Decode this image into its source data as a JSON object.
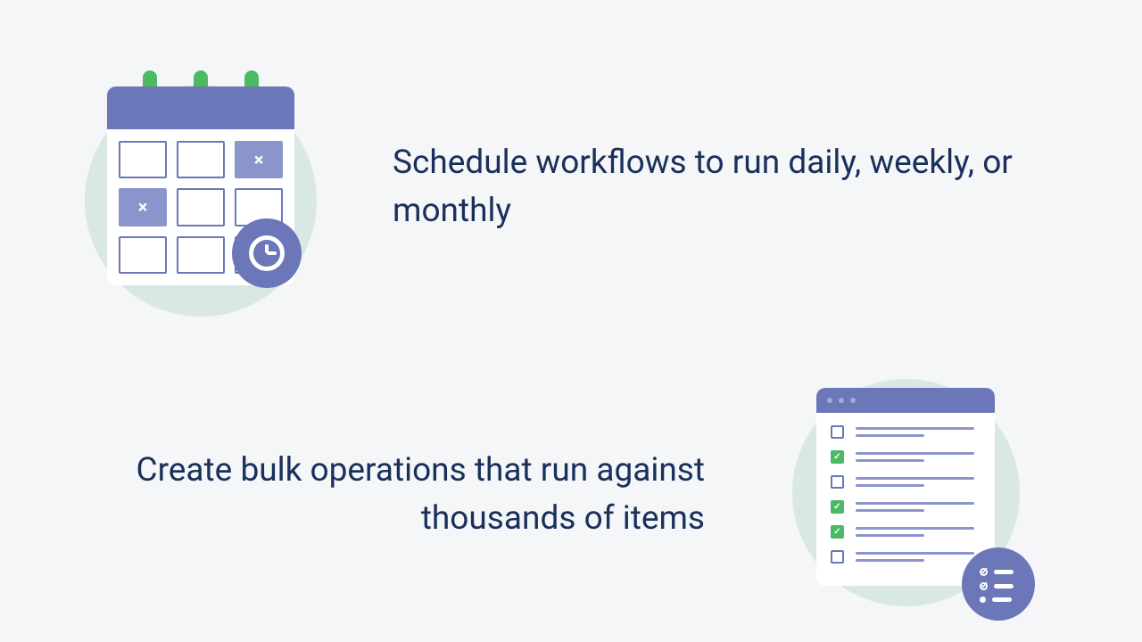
{
  "features": {
    "schedule": {
      "text": "Schedule workflows to run daily, weekly, or monthly",
      "icon": "calendar-clock"
    },
    "bulk": {
      "text": "Create bulk operations that run against thousands of items",
      "icon": "checklist-window"
    }
  },
  "colors": {
    "background": "#f4f6f8",
    "primary": "#6b77b8",
    "accent": "#4cb963",
    "text": "#1a2f5a",
    "circle": "#d9e8e4"
  }
}
